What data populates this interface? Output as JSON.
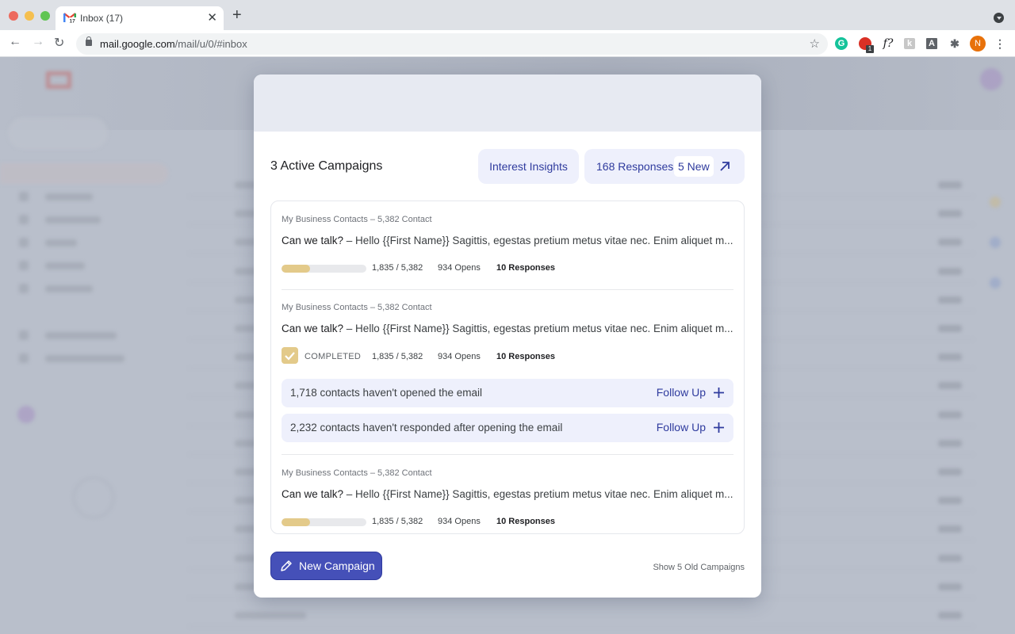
{
  "browser": {
    "tab_title": "Inbox (17)",
    "new_tab_label": "+",
    "url_host": "mail.google.com",
    "url_path": "/mail/u/0/#inbox",
    "extensions": {
      "grammarly": "G",
      "red_ext": "",
      "red_badge": "1",
      "f_ext": "f?",
      "k_ext": "k",
      "a_ext": "A",
      "profile_initial": "N"
    }
  },
  "modal": {
    "title": "3 Active Campaigns",
    "insights_label": "Interest Insights",
    "responses_label": "168 Responses",
    "new_badge": "5 New",
    "campaigns": [
      {
        "meta": "My Business Contacts – 5,382 Contact",
        "subject": "Can we talk?",
        "preview": " – Hello {{First Name}} Sagittis, egestas pretium metus vitae nec. Enim aliquet m...",
        "status": "in-progress",
        "progress": 0.34,
        "sent": "1,835 / 5,382",
        "opens": "934 Opens",
        "responses": "10 Responses"
      },
      {
        "meta": "My Business Contacts – 5,382 Contact",
        "subject": "Can we talk?",
        "preview": " – Hello {{First Name}} Sagittis, egestas pretium metus vitae nec. Enim aliquet m...",
        "status": "completed",
        "status_label": "COMPLETED",
        "sent": "1,835 / 5,382",
        "opens": "934 Opens",
        "responses": "10 Responses",
        "followups": [
          {
            "text": "1,718 contacts haven't opened the email",
            "action": "Follow Up"
          },
          {
            "text": "2,232 contacts haven't responded after opening the email",
            "action": "Follow Up"
          }
        ]
      },
      {
        "meta": "My Business Contacts – 5,382 Contact",
        "subject": "Can we talk?",
        "preview": " – Hello {{First Name}} Sagittis, egestas pretium metus vitae nec. Enim aliquet m...",
        "status": "in-progress",
        "progress": 0.34,
        "sent": "1,835 / 5,382",
        "opens": "934 Opens",
        "responses": "10 Responses"
      }
    ],
    "new_campaign_label": "New Campaign",
    "show_old_label": "Show 5 Old Campaigns"
  },
  "colors": {
    "accent": "#2f3b9e",
    "button": "#4550b8",
    "progress_fill": "#e3ca8a",
    "pill_bg": "#eef0fc"
  }
}
